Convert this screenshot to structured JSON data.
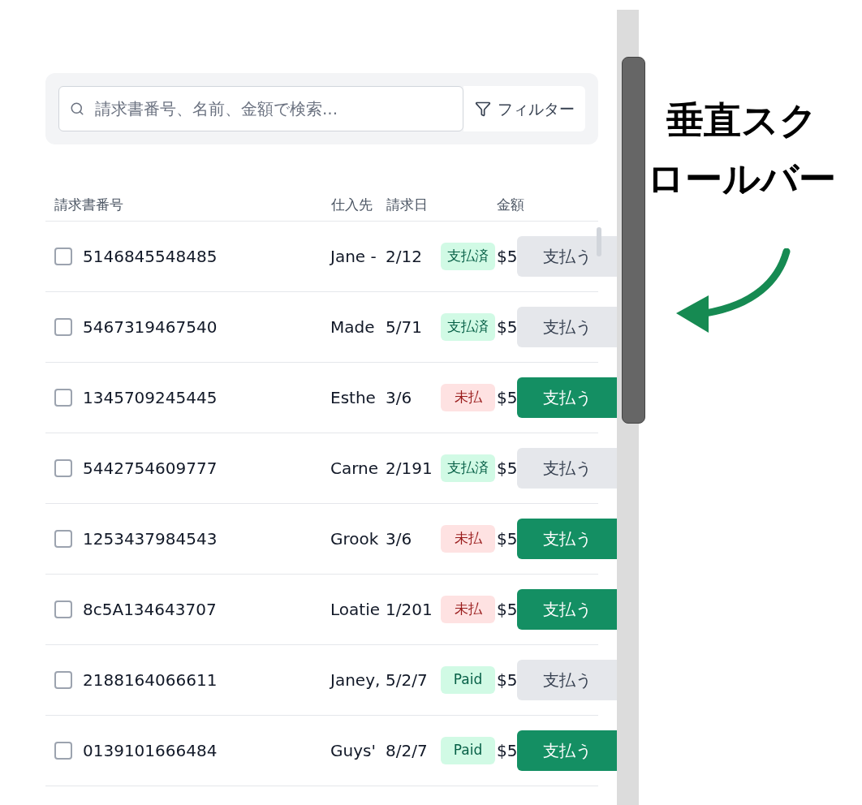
{
  "search": {
    "placeholder": "請求書番号、名前、金額で検索..."
  },
  "filter_button": {
    "label": "フィルター"
  },
  "table": {
    "columns": [
      "請求書番号",
      "仕入先",
      "請求日",
      "金額"
    ],
    "rows": [
      {
        "checked": false,
        "invoice": "5146845548485",
        "vendor": "Jane -",
        "date": "2/12",
        "kind": "paid",
        "badge": "支払済",
        "amount": "$5",
        "pay_button": {
          "label": "支払う",
          "highlighted": false
        }
      },
      {
        "checked": false,
        "invoice": "5467319467540",
        "vendor": "Made",
        "date": "5/71",
        "kind": "paid",
        "badge": "支払済",
        "amount": "$5",
        "pay_button": {
          "label": "支払う",
          "highlighted": false
        }
      },
      {
        "checked": false,
        "invoice": "1345709245445",
        "vendor": "Esthe",
        "date": "3/6",
        "kind": "unpaid",
        "badge": "未払",
        "amount": "$5",
        "pay_button": {
          "label": "支払う",
          "highlighted": true
        }
      },
      {
        "checked": false,
        "invoice": "5442754609777",
        "vendor": "Carne",
        "date": "2/191",
        "kind": "paid",
        "badge": "支払済",
        "amount": "$5",
        "pay_button": {
          "label": "支払う",
          "highlighted": false
        }
      },
      {
        "checked": false,
        "invoice": "1253437984543",
        "vendor": "Grook",
        "date": "3/6",
        "kind": "unpaid",
        "badge": "未払",
        "amount": "$5",
        "pay_button": {
          "label": "支払う",
          "highlighted": true
        }
      },
      {
        "checked": false,
        "invoice": "8c5A134643707",
        "vendor": "Loatie",
        "date": "1/201",
        "kind": "unpaid",
        "badge": "未払",
        "amount": "$5",
        "pay_button": {
          "label": "支払う",
          "highlighted": true
        }
      },
      {
        "checked": false,
        "invoice": "2188164066611",
        "vendor": "Janey,",
        "date": "5/2/7",
        "kind": "paid",
        "badge": "Paid",
        "amount": "$5",
        "pay_button": {
          "label": "支払う",
          "highlighted": false
        }
      },
      {
        "checked": false,
        "invoice": "0139101666484",
        "vendor": "Guys'",
        "date": "8/2/7",
        "kind": "paid",
        "badge": "Paid",
        "amount": "$5",
        "pay_button": {
          "label": "支払う",
          "highlighted": true
        }
      }
    ]
  },
  "annotation": {
    "lines": [
      "垂直スク",
      "ロールバー"
    ]
  }
}
